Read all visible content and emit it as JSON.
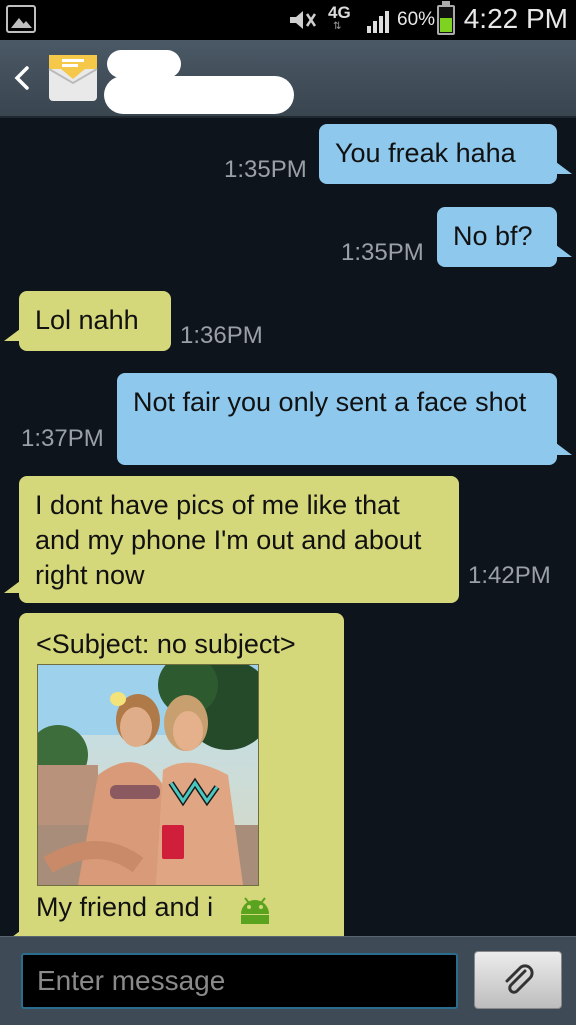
{
  "status_bar": {
    "network": "4G",
    "battery_pct": "60%",
    "battery_level": 0.6,
    "time": "4:22 PM"
  },
  "header": {
    "contact_icon": "envelope-icon",
    "back_icon": "chevron-left-icon"
  },
  "messages": [
    {
      "dir": "out",
      "text": "You freak haha",
      "time": "1:35PM"
    },
    {
      "dir": "out",
      "text": "No bf?",
      "time": "1:35PM"
    },
    {
      "dir": "in",
      "text": "Lol nahh",
      "time": "1:36PM"
    },
    {
      "dir": "out",
      "text": "Not fair you only sent a face shot",
      "time": "1:37PM"
    },
    {
      "dir": "in",
      "text": "I dont have pics of me like that and my phone I'm out and about right now",
      "time": "1:42PM"
    },
    {
      "dir": "in",
      "subject": "<Subject: no subject>",
      "caption": "My friend and i",
      "caption_icon": "android-icon",
      "has_image": true
    }
  ],
  "composer": {
    "placeholder": "Enter message",
    "attach_icon": "paperclip-icon"
  },
  "colors": {
    "outgoing_bubble": "#8ec8ec",
    "incoming_bubble": "#d4d77a",
    "background": "#0e141b"
  }
}
